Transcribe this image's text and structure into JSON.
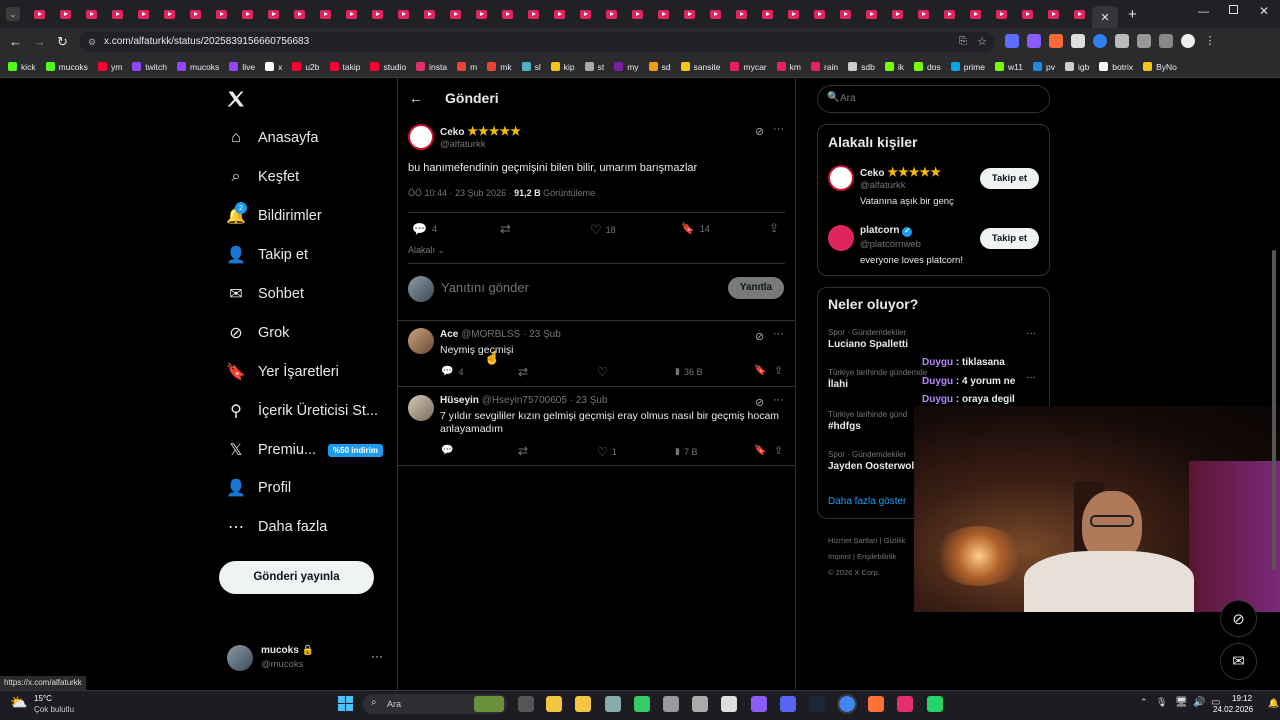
{
  "browser": {
    "url": "x.com/alfaturkk/status/2025839156660756683",
    "status_url": "https://x.com/alfaturkk",
    "bookmarks": [
      {
        "label": "kick",
        "color": "#53fc18"
      },
      {
        "label": "mucoks",
        "color": "#53fc18"
      },
      {
        "label": "ym",
        "color": "#ff0033"
      },
      {
        "label": "twitch",
        "color": "#9146ff"
      },
      {
        "label": "mucoks",
        "color": "#9146ff"
      },
      {
        "label": "live",
        "color": "#9146ff"
      },
      {
        "label": "x",
        "color": "#ffffff"
      },
      {
        "label": "u2b",
        "color": "#ff0033"
      },
      {
        "label": "takip",
        "color": "#ff0033"
      },
      {
        "label": "studio",
        "color": "#ff0033"
      },
      {
        "label": "insta",
        "color": "#e1306c"
      },
      {
        "label": "m",
        "color": "#ea4335"
      },
      {
        "label": "mk",
        "color": "#ea4335"
      },
      {
        "label": "sl",
        "color": "#4fb0c6"
      },
      {
        "label": "kip",
        "color": "#f5c518"
      },
      {
        "label": "st",
        "color": "#aaaaaa"
      },
      {
        "label": "my",
        "color": "#7b1fa2"
      },
      {
        "label": "sd",
        "color": "#f39c12"
      },
      {
        "label": "sansite",
        "color": "#f5c518"
      },
      {
        "label": "mycar",
        "color": "#e91e63"
      },
      {
        "label": "km",
        "color": "#e91e63"
      },
      {
        "label": "rain",
        "color": "#e91e63"
      },
      {
        "label": "sdb",
        "color": "#cccccc"
      },
      {
        "label": "ik",
        "color": "#76ff03"
      },
      {
        "label": "dos",
        "color": "#76ff03"
      },
      {
        "label": "prime",
        "color": "#00a8e1"
      },
      {
        "label": "w11",
        "color": "#76ff03"
      },
      {
        "label": "pv",
        "color": "#1e88e5"
      },
      {
        "label": "igb",
        "color": "#cccccc"
      },
      {
        "label": "botrix",
        "color": "#ffffff"
      },
      {
        "label": "ByNo",
        "color": "#f5c518"
      }
    ]
  },
  "nav": {
    "items": [
      {
        "label": "Anasayfa",
        "icon": "home-icon"
      },
      {
        "label": "Keşfet",
        "icon": "search-icon"
      },
      {
        "label": "Bildirimler",
        "icon": "bell-icon",
        "badge": "2"
      },
      {
        "label": "Takip et",
        "icon": "person-add-icon"
      },
      {
        "label": "Sohbet",
        "icon": "mail-icon"
      },
      {
        "label": "Grok",
        "icon": "grok-icon"
      },
      {
        "label": "Yer İşaretleri",
        "icon": "bookmark-icon"
      },
      {
        "label": "İçerik Üreticisi St...",
        "icon": "creator-icon"
      },
      {
        "label": "Premiu...",
        "icon": "x-logo-icon",
        "badge": "%50 indirim"
      },
      {
        "label": "Profil",
        "icon": "profile-icon"
      },
      {
        "label": "Daha fazla",
        "icon": "more-circle-icon"
      }
    ],
    "post_button": "Gönderi yayınla",
    "account": {
      "name": "mucoks",
      "handle": "@mucoks"
    }
  },
  "main": {
    "header_title": "Gönderi",
    "tweet": {
      "name": "Ceko",
      "stars": "★★★★★",
      "handle": "@alfaturkk",
      "text": "bu hanımefendinin geçmişini bilen bilir, umarım barışmazlar",
      "meta": "ÖÖ 10:44 · 23 Şub 2026 · ",
      "views": "91,2 B",
      "views_label": "Görüntüleme",
      "replies": "4",
      "likes": "18",
      "bookmarks": "14",
      "relevance": "Alakalı"
    },
    "reply_box": {
      "placeholder": "Yanıtını gönder",
      "button": "Yanıtla"
    },
    "replies": [
      {
        "name": "Ace",
        "handle": "@MORBLSS",
        "date": "23 Şub",
        "text": "Neymiş geçmişi",
        "replies": "4",
        "retweets": "",
        "likes": "",
        "views": "36 B"
      },
      {
        "name": "Hüseyin",
        "handle": "@Hseyin75700605",
        "date": "23 Şub",
        "text": "7 yıldır sevgililer kızın gelmişi geçmişi eray olmus nasıl bir geçmiş hocam anlayamadım",
        "replies": "",
        "retweets": "",
        "likes": "1",
        "views": "7 B"
      }
    ]
  },
  "sidebar": {
    "search_placeholder": "Ara",
    "related_title": "Alakalı kişiler",
    "people": [
      {
        "name": "Ceko",
        "stars": "★★★★★",
        "handle": "@alfaturkk",
        "bio": "Vatanına aşık bir genç",
        "button": "Takip et"
      },
      {
        "name": "platcorn",
        "verified": true,
        "handle": "@platcornweb",
        "bio": "everyone loves platcorn!",
        "button": "Takip et"
      }
    ],
    "trends_title": "Neler oluyor?",
    "trends": [
      {
        "context": "Spor · Gündemdekiler",
        "title": "Luciano Spalletti"
      },
      {
        "context": "Türkiye tarihinde gündemde",
        "title": "İlahi"
      },
      {
        "context": "Türkiye tarihinde günd",
        "title": "#hdfgs"
      },
      {
        "context": "Spor · Gündemdekiler",
        "title": "Jayden Oosterwolde"
      }
    ],
    "show_more": "Daha fazla göster",
    "footer": [
      "Hizmet Şartları",
      "Gizlilik",
      "Imprint",
      "Erişilebilirlik",
      "© 2026 X Corp."
    ]
  },
  "overlay_chat": [
    {
      "user": "Duygu",
      "msg": ": tiklasana"
    },
    {
      "user": "Duygu",
      "msg": ": 4 yorum ne"
    },
    {
      "user": "Duygu",
      "msg": ": oraya degil"
    }
  ],
  "taskbar": {
    "weather_temp": "15°C",
    "weather_desc": "Çok bulutlu",
    "search": "Ara",
    "time": "19:12",
    "date": "24.02.2026"
  }
}
